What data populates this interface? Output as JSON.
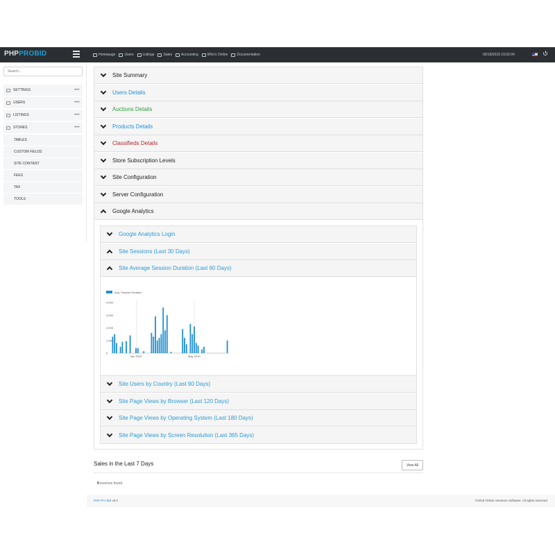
{
  "app": {
    "logo_part1": "PHP",
    "logo_part2": "PRO",
    "logo_part3": "BID"
  },
  "topnav": [
    {
      "label": "Homepage",
      "icon": "monitor-icon"
    },
    {
      "label": "Users",
      "icon": "users-icon"
    },
    {
      "label": "Listings",
      "icon": "cube-icon"
    },
    {
      "label": "Sales",
      "icon": "calendar-icon"
    },
    {
      "label": "Accounting",
      "icon": "wallet-icon"
    },
    {
      "label": "Who's Online",
      "icon": "glasses-icon"
    },
    {
      "label": "Documentation",
      "icon": "book-icon"
    }
  ],
  "header": {
    "datetime": "05/18/2019 15:02:04",
    "flag": "us-flag-icon",
    "power": "power-icon"
  },
  "sidebar": {
    "search_placeholder": "Search...",
    "items": [
      {
        "label": "SETTINGS",
        "dots": "•••"
      },
      {
        "label": "USERS",
        "dots": "•••"
      },
      {
        "label": "LISTINGS",
        "dots": "•••"
      },
      {
        "label": "STORES",
        "dots": "•••"
      },
      {
        "label": "TABLES"
      },
      {
        "label": "CUSTOM FIELDS"
      },
      {
        "label": "SITE CONTENT"
      },
      {
        "label": "FEES"
      },
      {
        "label": "TAX"
      },
      {
        "label": "TOOLS"
      }
    ]
  },
  "accordion": [
    {
      "label": "Site Summary",
      "color": "#222222"
    },
    {
      "label": "Users Details",
      "color": "#1e90d6"
    },
    {
      "label": "Auctions Details",
      "color": "#2e9e3c"
    },
    {
      "label": "Products Details",
      "color": "#1e90d6"
    },
    {
      "label": "Classifieds Details",
      "color": "#b0262e"
    },
    {
      "label": "Store Subscription Levels",
      "color": "#222222"
    },
    {
      "label": "Site Configuration",
      "color": "#222222"
    },
    {
      "label": "Server Configuration",
      "color": "#222222"
    },
    {
      "label": "Google Analytics",
      "color": "#222222"
    }
  ],
  "analytics": [
    {
      "label": "Google Analytics Login"
    },
    {
      "label": "Site Sessions (Last 30 Days)"
    },
    {
      "label": "Site Average Session Duration (Last 60 Days)"
    },
    {
      "label": "Site Users by Country (Last 90 Days)"
    },
    {
      "label": "Site Page Views by Browser (Last 120 Days)"
    },
    {
      "label": "Site Page Views by Operating System (Last 180 Days)"
    },
    {
      "label": "Site Page Views by Screen Resolution (Last 365 Days)"
    }
  ],
  "chart_data": {
    "type": "bar",
    "legend": [
      "Avg. Session Duration"
    ],
    "legend_placement": "top-left",
    "color": "#1e8fd0",
    "ylim": [
      0,
      4000
    ],
    "yticks": [
      "0",
      "1,000",
      "2,000",
      "3,000",
      "4,000"
    ],
    "xticks": [
      "Apr 2019",
      "May 2019"
    ],
    "series": [
      {
        "name": "Avg. Session Duration",
        "values": [
          1300,
          1500,
          800,
          0,
          500,
          900,
          0,
          950,
          0,
          1400,
          0,
          0,
          400,
          400,
          0,
          0,
          150,
          0,
          0,
          0,
          1600,
          1300,
          2900,
          1000,
          1200,
          1500,
          3600,
          1800,
          3000,
          0,
          100,
          0,
          0,
          0,
          0,
          0,
          1900,
          1200,
          700,
          0,
          2300,
          1500,
          2100,
          800,
          600,
          0,
          300,
          500,
          0,
          0,
          0,
          0,
          0,
          0,
          0,
          0,
          0,
          0,
          0,
          1000
        ]
      }
    ]
  },
  "sales": {
    "title": "Sales in the Last 7 Days",
    "view_all": "View All",
    "invoices_count": "0",
    "invoices_text": " invoices found."
  },
  "footer": {
    "product": "PHP Pro Bid",
    "version": " v8.0",
    "copyright": "©2019 Online Ventures Software. All rights reserved."
  }
}
